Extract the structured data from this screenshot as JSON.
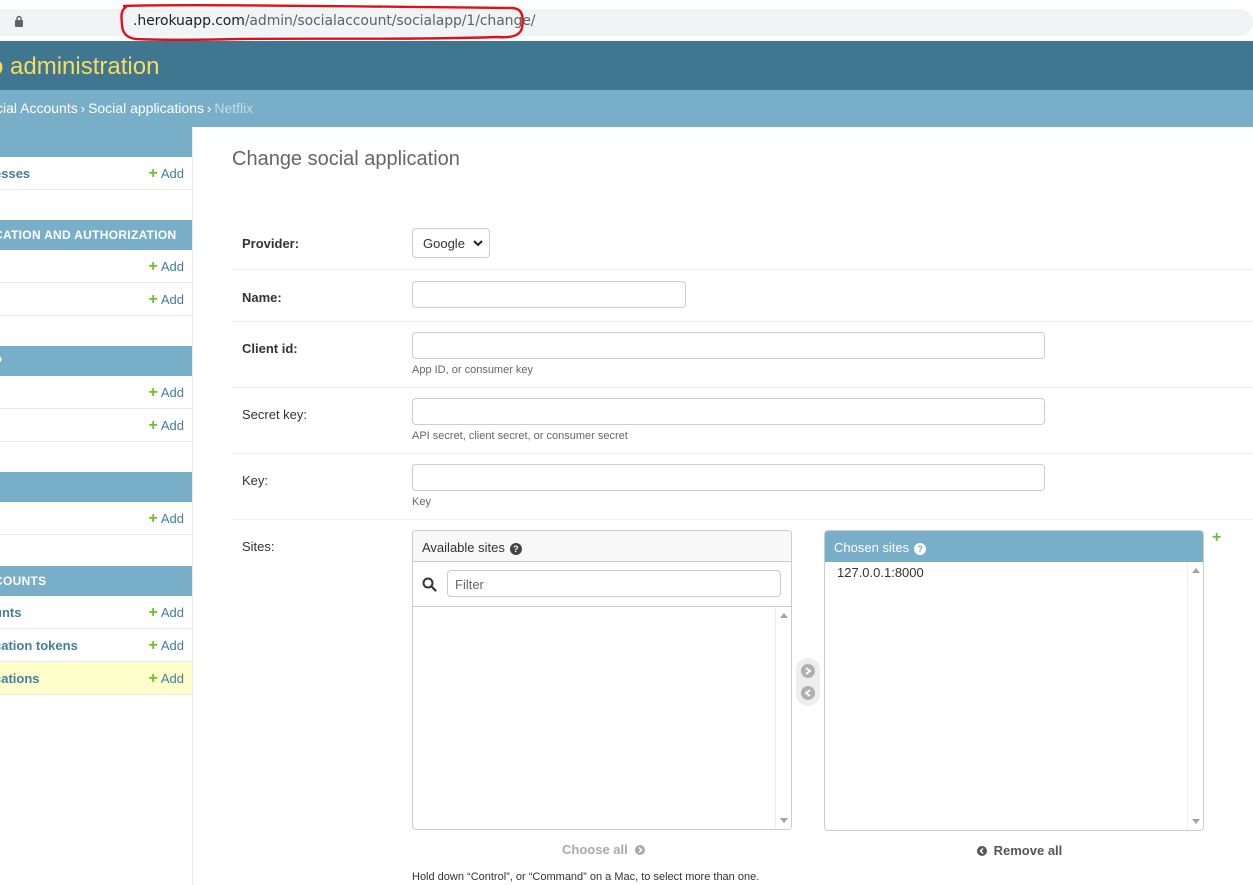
{
  "browser": {
    "url_host": ".herokuapp.com",
    "url_path": "/admin/socialaccount/socialapp/1/change/"
  },
  "header": {
    "site_title": "o administration"
  },
  "breadcrumbs": {
    "items": [
      "cial Accounts",
      "Social applications"
    ],
    "separator": "›",
    "current": "Netflix"
  },
  "sidebar": {
    "add_label": "Add",
    "modules": [
      {
        "caption": "",
        "models": [
          "esses"
        ]
      },
      {
        "caption": "CATION AND AUTHORIZATION",
        "models": [
          "",
          ""
        ]
      },
      {
        "caption": "P",
        "models": [
          "",
          ""
        ]
      },
      {
        "caption": "",
        "models": [
          ""
        ]
      },
      {
        "caption": "COUNTS",
        "models": [
          "unts",
          "cation tokens",
          "cations"
        ]
      }
    ]
  },
  "main": {
    "page_title": "Change social application",
    "fields": {
      "provider": {
        "label": "Provider:",
        "value": "Google"
      },
      "name": {
        "label": "Name:",
        "value": ""
      },
      "client_id": {
        "label": "Client id:",
        "value": "",
        "help": "App ID, or consumer key"
      },
      "secret": {
        "label": "Secret key:",
        "value": "",
        "help": "API secret, client secret, or consumer secret"
      },
      "key": {
        "label": "Key:",
        "value": "",
        "help": "Key"
      },
      "sites": {
        "label": "Sites:",
        "available_title": "Available sites",
        "filter_placeholder": "Filter",
        "chosen_title": "Chosen sites",
        "chosen_options": [
          "127.0.0.1:8000"
        ],
        "choose_all": "Choose all",
        "remove_all": "Remove all",
        "help": "Hold down “Control”, or “Command” on a Mac, to select more than one."
      }
    }
  },
  "colors": {
    "header_bg": "#417690",
    "breadcrumb_bg": "#79aec8",
    "title_yellow": "#f5dd5d",
    "link_blue": "#447e9b",
    "add_green": "#70bf2b",
    "selected_row": "#ffffcc",
    "annotation_red": "#e0101a"
  }
}
